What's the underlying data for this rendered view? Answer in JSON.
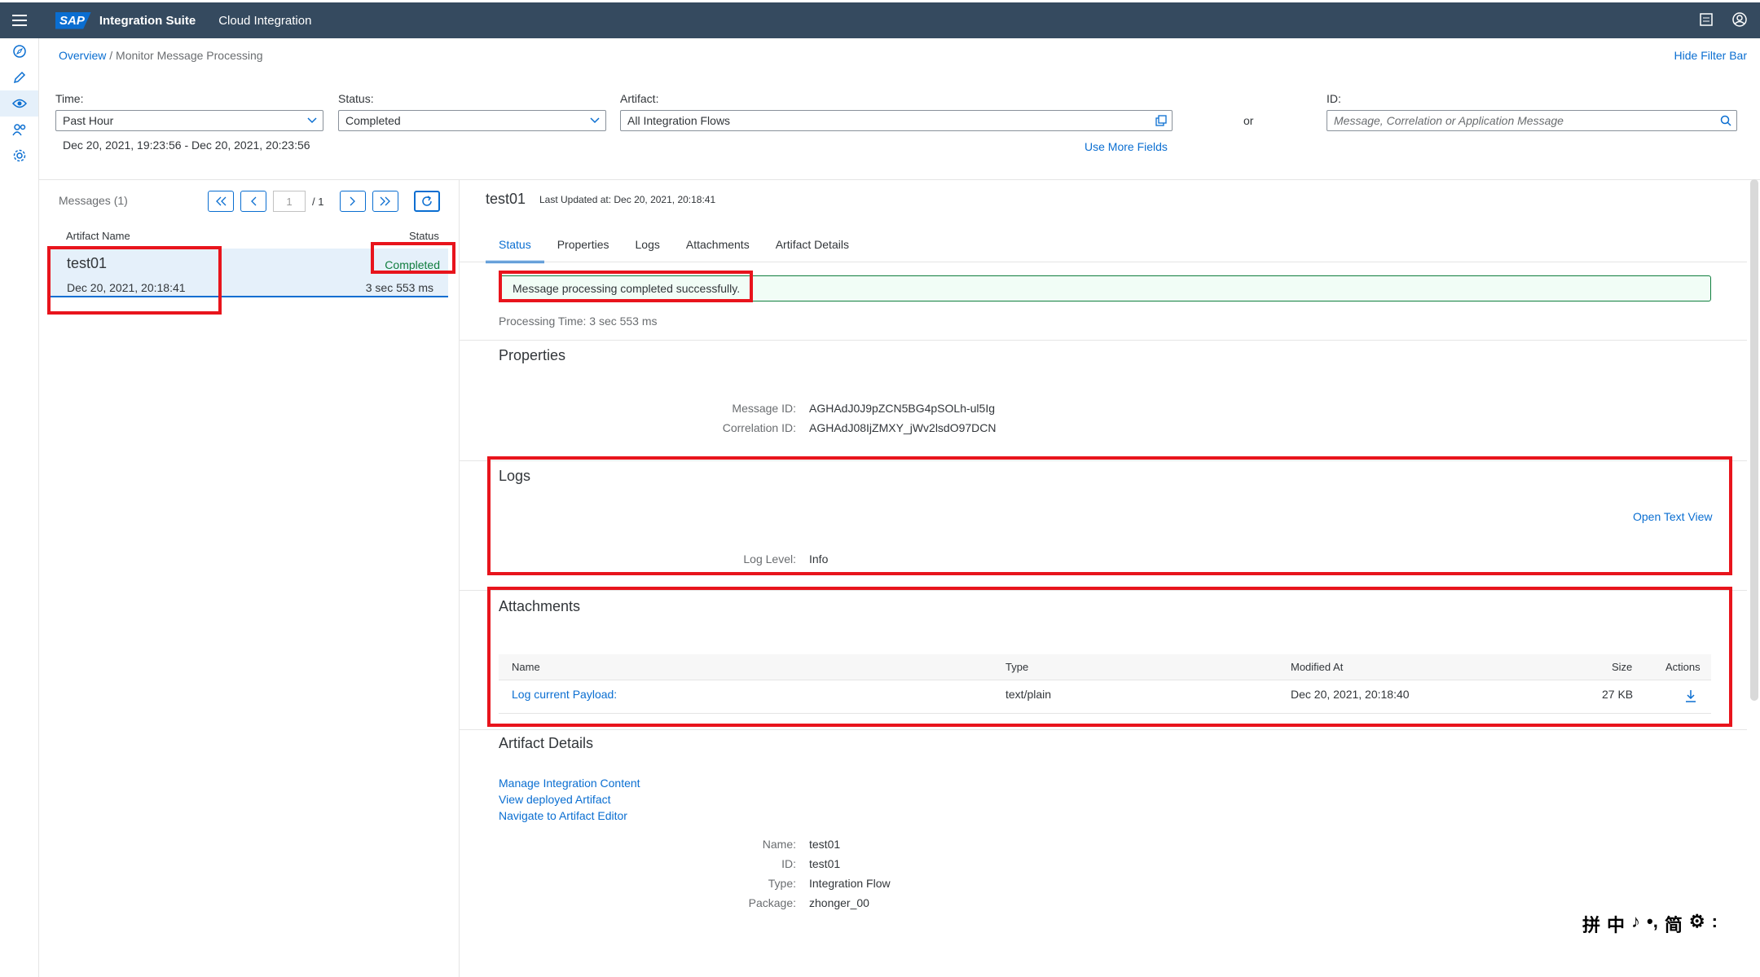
{
  "shell": {
    "logo": "SAP",
    "product": "Integration Suite",
    "subtitle": "Cloud Integration"
  },
  "breadcrumb": {
    "overview": "Overview",
    "separator": "/",
    "current": "Monitor Message Processing"
  },
  "hide_filter_bar": "Hide Filter Bar",
  "filters": {
    "time_label": "Time:",
    "time_value": "Past Hour",
    "status_label": "Status:",
    "status_value": "Completed",
    "artifact_label": "Artifact:",
    "artifact_value": "All Integration Flows",
    "id_label": "ID:",
    "id_placeholder": "Message, Correlation or Application Message",
    "or": "or",
    "date_range": "Dec 20, 2021, 19:23:56 - Dec 20, 2021, 20:23:56",
    "use_more_fields": "Use More Fields"
  },
  "list": {
    "title": "Messages (1)",
    "page": "1",
    "page_total": "/ 1",
    "col_artifact": "Artifact Name",
    "col_status": "Status",
    "rows": [
      {
        "name": "test01",
        "date": "Dec 20, 2021, 20:18:41",
        "status": "Completed",
        "duration": "3 sec 553 ms"
      }
    ]
  },
  "detail": {
    "title": "test01",
    "last_updated": "Last Updated at: Dec 20, 2021, 20:18:41",
    "tabs": [
      "Status",
      "Properties",
      "Logs",
      "Attachments",
      "Artifact Details"
    ],
    "status_message": "Message processing completed successfully.",
    "processing_time": "Processing Time: 3 sec 553 ms",
    "properties": {
      "title": "Properties",
      "message_id_label": "Message ID:",
      "message_id": "AGHAdJ0J9pZCN5BG4pSOLh-ul5Ig",
      "correlation_id_label": "Correlation ID:",
      "correlation_id": "AGHAdJ08IjZMXY_jWv2lsdO97DCN"
    },
    "logs": {
      "title": "Logs",
      "open_text_view": "Open Text View",
      "log_level_label": "Log Level:",
      "log_level": "Info"
    },
    "attachments": {
      "title": "Attachments",
      "columns": [
        "Name",
        "Type",
        "Modified At",
        "Size",
        "Actions"
      ],
      "rows": [
        {
          "name": "Log current Payload:",
          "type": "text/plain",
          "modified": "Dec 20, 2021, 20:18:40",
          "size": "27 KB"
        }
      ]
    },
    "artifact": {
      "title": "Artifact Details",
      "link_manage": "Manage Integration Content",
      "link_view": "View deployed Artifact",
      "link_navigate": "Navigate to Artifact Editor",
      "name_label": "Name:",
      "name": "test01",
      "id_label": "ID:",
      "id": "test01",
      "type_label": "Type:",
      "type": "Integration Flow",
      "package_label": "Package:",
      "package": "zhonger_00"
    }
  },
  "ime_bar": [
    "拼",
    "中",
    "♪",
    "•,",
    "简",
    "⚙",
    ":"
  ],
  "colors": {
    "shell": "#354a5f",
    "accent": "#0a6ed1",
    "success": "#107e3e",
    "highlight": "#e8141c"
  }
}
